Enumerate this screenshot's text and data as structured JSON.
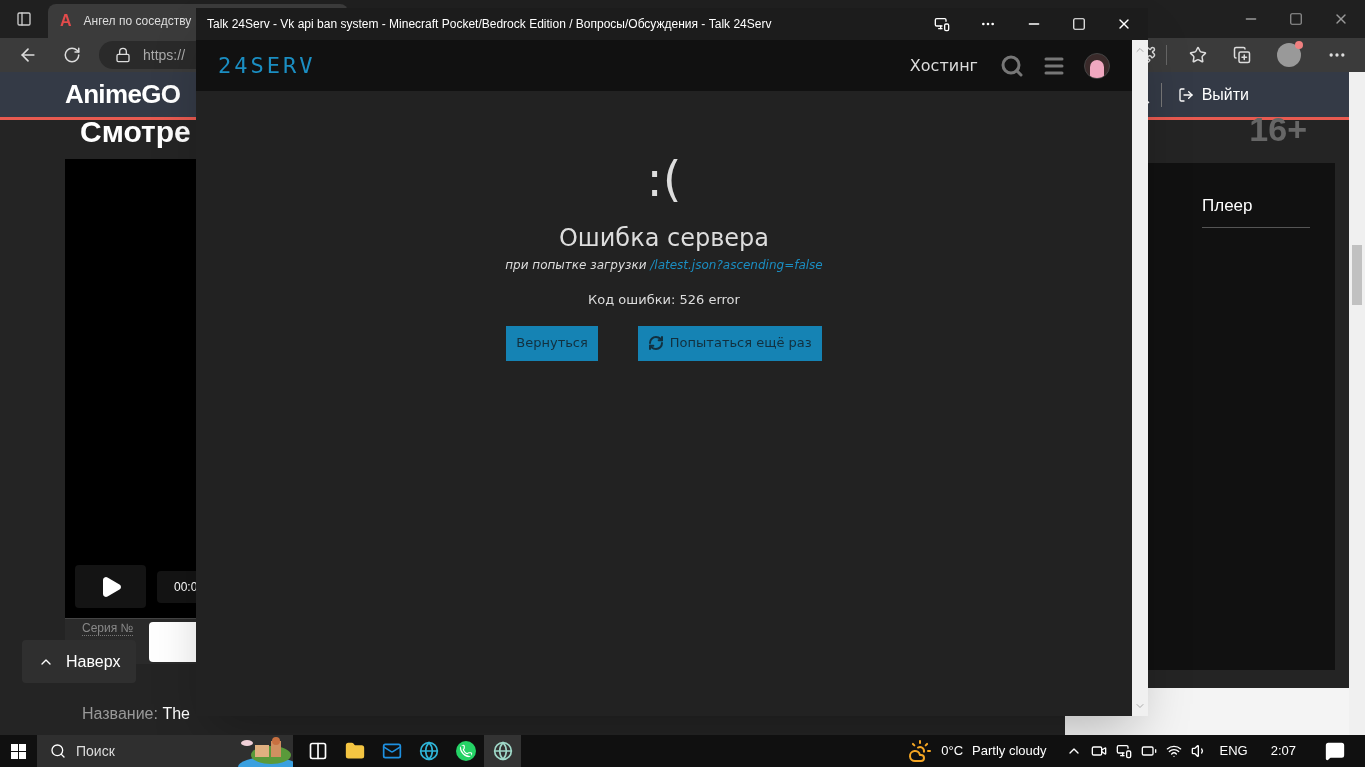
{
  "browser": {
    "favicon": "A",
    "tab_title": "Ангел по соседству",
    "address": "https://"
  },
  "site": {
    "logo": "AnimeGO",
    "logout": "Выйти",
    "heading": "Смотре",
    "age": "16+",
    "time": "00:0",
    "episode_label": "Серия №",
    "player_tab": "Плеер",
    "title_label": "Название:",
    "title_value": "The",
    "to_top": "Наверх"
  },
  "popup": {
    "title": "Talk 24Serv - Vk api ban system - Minecraft Pocket/Bedrock Edition / Вопросы/Обсуждения - Talk 24Serv",
    "logo": "24SERV",
    "nav_link": "Хостинг",
    "face": ":(",
    "error_title": "Ошибка сервера",
    "subtitle": "при попытке загрузки",
    "url": "/latest.json?ascending=false",
    "code": "Код ошибки: 526 error",
    "buttons": [
      {
        "kind": "back",
        "label": "Вернуться"
      },
      {
        "kind": "retry",
        "label": "Попытаться ещё раз"
      }
    ]
  },
  "taskbar": {
    "search_placeholder": "Поиск",
    "apps": [
      {
        "kind": "taskview",
        "selected": false
      },
      {
        "kind": "explorer",
        "selected": false
      },
      {
        "kind": "mail",
        "selected": false
      },
      {
        "kind": "edge",
        "selected": false
      },
      {
        "kind": "whatsapp",
        "selected": false
      },
      {
        "kind": "app",
        "selected": true
      }
    ],
    "temperature": "0°C",
    "weather": "Partly cloudy",
    "language": "ENG",
    "time": "2:07"
  }
}
